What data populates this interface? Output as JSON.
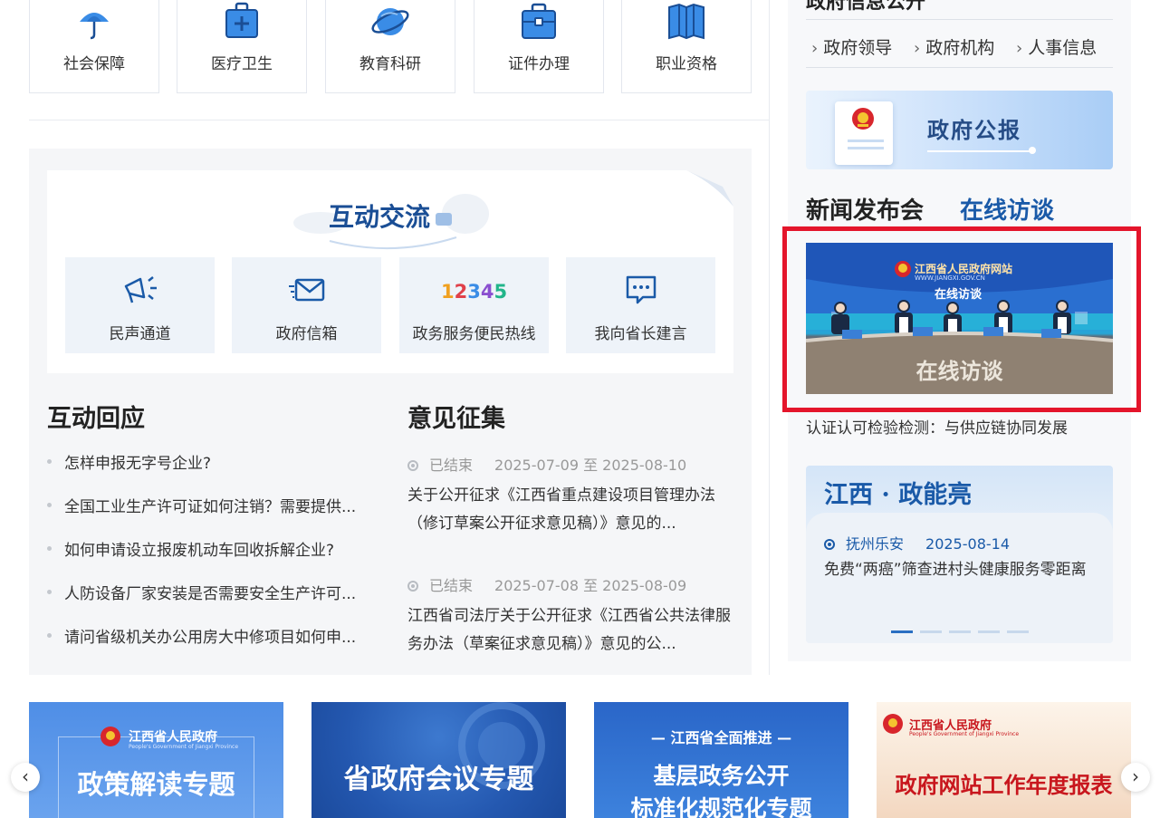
{
  "top_tiles": [
    {
      "label": "社会保障",
      "icon": "umbrella-icon"
    },
    {
      "label": "医疗卫生",
      "icon": "medical-kit-icon"
    },
    {
      "label": "教育科研",
      "icon": "planet-icon"
    },
    {
      "label": "证件办理",
      "icon": "briefcase-icon"
    },
    {
      "label": "职业资格",
      "icon": "book-icon"
    }
  ],
  "interaction": {
    "title": "互动交流",
    "services": [
      {
        "label": "民声通道",
        "icon": "megaphone-icon"
      },
      {
        "label": "政府信箱",
        "icon": "mail-icon"
      },
      {
        "label": "政务服务便民热线",
        "icon": "hotline-12345-icon",
        "number": "12345"
      },
      {
        "label": "我向省长建言",
        "icon": "chat-bubble-icon"
      }
    ]
  },
  "responses": {
    "title": "互动回应",
    "items": [
      "怎样申报无字号企业?",
      "全国工业生产许可证如何注销？需要提供...",
      "如何申请设立报废机动车回收拆解企业?",
      "人防设备厂家安装是否需要安全生产许可...",
      "请问省级机关办公用房大中修项目如何申..."
    ]
  },
  "opinions": {
    "title": "意见征集",
    "items": [
      {
        "status": "已结束",
        "dates": "2025-07-09 至 2025-08-10",
        "text": "关于公开征求《江西省重点建设项目管理办法（修订草案公开征求意见稿）》意见的..."
      },
      {
        "status": "已结束",
        "dates": "2025-07-08 至 2025-08-09",
        "text": "江西省司法厅关于公开征求《江西省公共法律服务办法（草案征求意见稿）》意见的公..."
      }
    ]
  },
  "right": {
    "info_title": "政府信息公开",
    "info_links": [
      "政府领导",
      "政府机构",
      "人事信息"
    ],
    "gazette_label": "政府公报",
    "tab_press": "新闻发布会",
    "tab_interview": "在线访谈",
    "video_banner_title": "江西省人民政府网站",
    "video_banner_url": "WWW.JIANGXI.GOV.CN",
    "video_banner_sub": "在线访谈",
    "video_desk_text": "在线访谈",
    "video_caption": "认证认可检验检测：与供应链协同发展",
    "jx_title": "江西 · 政能亮",
    "jx_source": "抚州乐安",
    "jx_date": "2025-08-14",
    "jx_text": "免费“两癌”筛查进村头健康服务零距离"
  },
  "banners": [
    {
      "top": "江西省人民政府",
      "tiny": "People's Government of Jiangxi Province",
      "main": "政策解读专题"
    },
    {
      "main": "省政府会议专题"
    },
    {
      "top": "— 江西省全面推进 —",
      "main": "基层政务公开",
      "main2": "标准化规范化专题"
    },
    {
      "top": "江西省人民政府",
      "tiny": "People's Government of Jiangxi Province",
      "main": "政府网站工作年度报表"
    }
  ],
  "nav": {
    "prev": "‹",
    "next": "›"
  },
  "colors": {
    "accent": "#1a5aa8",
    "highlight": "#e4152b",
    "panel_bg": "#f5f6f8"
  }
}
